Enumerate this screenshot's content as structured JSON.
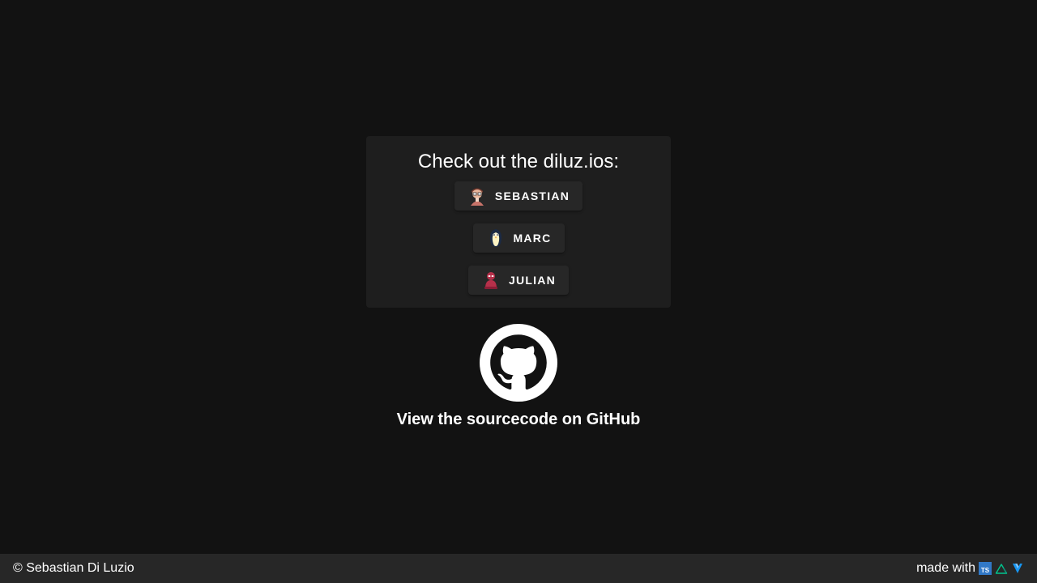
{
  "card": {
    "title": "Check out the diluz.ios:",
    "people": [
      {
        "name": "SEBASTIAN",
        "avatar_icon": "sebastian-avatar-icon"
      },
      {
        "name": "MARC",
        "avatar_icon": "penguin-avatar-icon"
      },
      {
        "name": "JULIAN",
        "avatar_icon": "julian-avatar-icon"
      }
    ]
  },
  "github": {
    "label": "View the sourcecode on GitHub",
    "icon": "github-icon"
  },
  "footer": {
    "copyright": "© Sebastian Di Luzio",
    "made_with": "made with",
    "tech_icons": [
      "typescript-icon",
      "nuxt-icon",
      "vuetify-icon"
    ]
  },
  "colors": {
    "background": "#121212",
    "card": "#1e1e1e",
    "button": "#272727",
    "footer": "#272727",
    "typescript": "#3178c6",
    "nuxt": "#00c58e",
    "vuetify": "#1697f6"
  }
}
